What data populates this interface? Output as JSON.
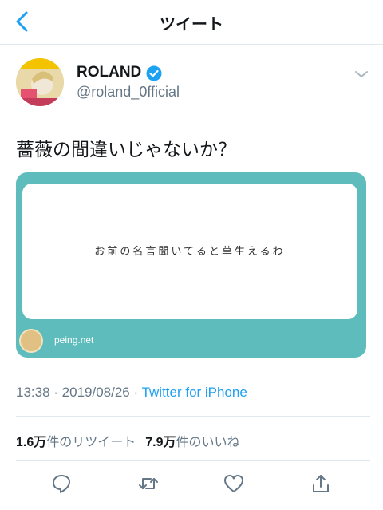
{
  "header": {
    "title": "ツイート",
    "back_icon": "chevron-left-icon"
  },
  "author": {
    "name": "ROLAND",
    "handle": "@roland_0fficial",
    "verified": true
  },
  "tweet": {
    "text": "薔薇の間違いじゃないか？"
  },
  "card": {
    "message": "お前の名言聞いてると草生えるわ",
    "domain": "peing.net"
  },
  "meta": {
    "time": "13:38",
    "separator": " · ",
    "date": "2019/08/26",
    "separator2": " · ",
    "app": "Twitter for iPhone"
  },
  "stats": {
    "retweets_count": "1.6万",
    "retweets_label": "件のリツイート",
    "likes_count": "7.9万",
    "likes_label": "件のいいね"
  },
  "actions": [
    "reply-icon",
    "retweet-icon",
    "like-icon",
    "share-icon"
  ],
  "colors": {
    "accent": "#1da1f2",
    "card": "#5ebdbc",
    "muted": "#657786"
  }
}
